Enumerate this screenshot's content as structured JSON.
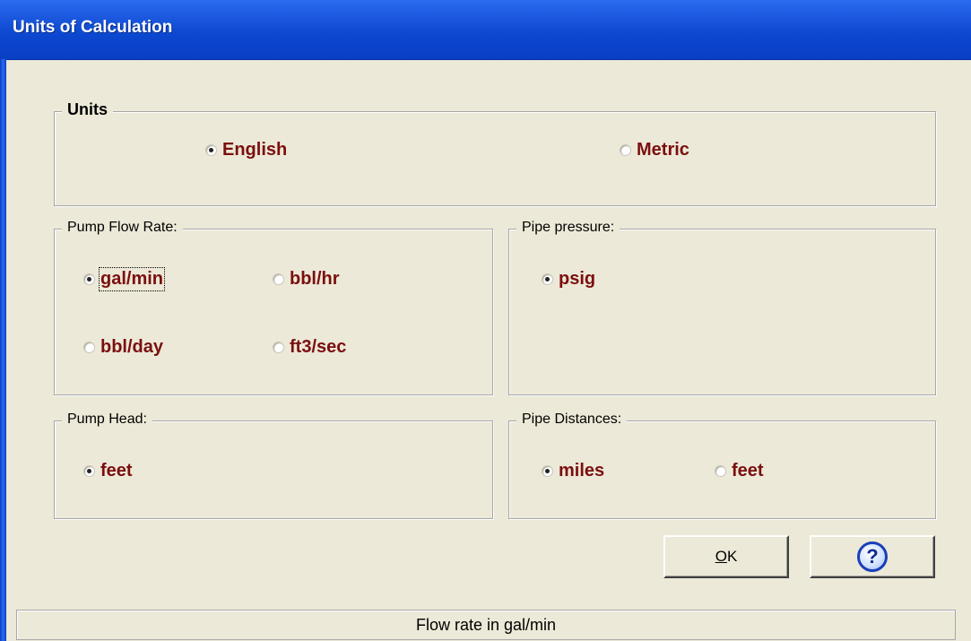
{
  "window": {
    "title": "Units of Calculation"
  },
  "units": {
    "legend": "Units",
    "options": [
      {
        "label": "English",
        "selected": true
      },
      {
        "label": "Metric",
        "selected": false
      }
    ]
  },
  "pump_flow_rate": {
    "legend": "Pump Flow Rate:",
    "options": [
      {
        "label": "gal/min",
        "selected": true
      },
      {
        "label": "bbl/hr",
        "selected": false
      },
      {
        "label": "bbl/day",
        "selected": false
      },
      {
        "label": "ft3/sec",
        "selected": false
      }
    ]
  },
  "pipe_pressure": {
    "legend": "Pipe pressure:",
    "options": [
      {
        "label": "psig",
        "selected": true
      }
    ]
  },
  "pump_head": {
    "legend": "Pump Head:",
    "options": [
      {
        "label": "feet",
        "selected": true
      }
    ]
  },
  "pipe_distances": {
    "legend": "Pipe Distances:",
    "options": [
      {
        "label": "miles",
        "selected": true
      },
      {
        "label": "feet",
        "selected": false
      }
    ]
  },
  "buttons": {
    "ok_mnemonic": "O",
    "ok_rest": "K",
    "help_icon": "question-circle-icon",
    "help_glyph": "?"
  },
  "status_bar": {
    "text": "Flow rate in gal/min"
  },
  "colors": {
    "option_text": "#7b0f0f",
    "title_bar": "#0a47cf"
  }
}
